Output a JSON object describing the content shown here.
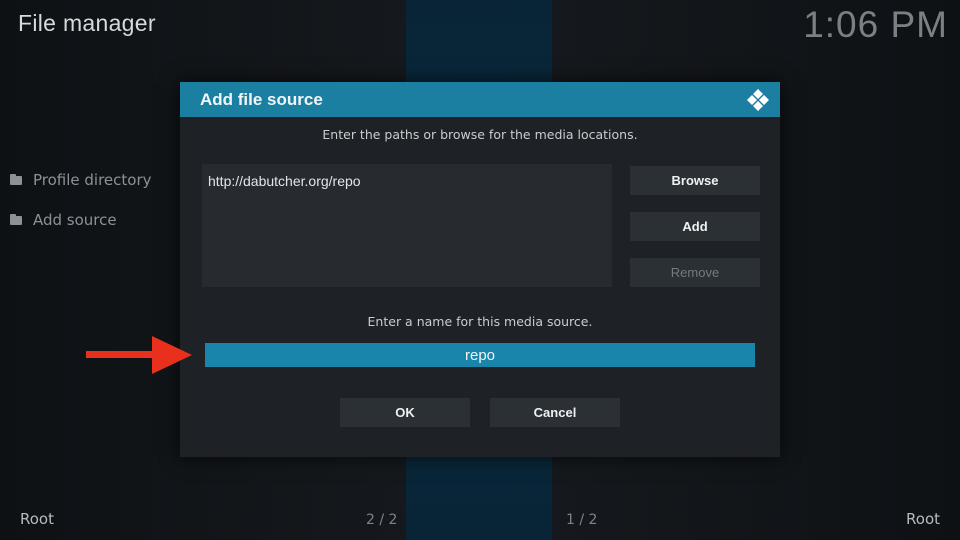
{
  "app": {
    "title": "File manager",
    "clock": "1:06 PM"
  },
  "left_panel": {
    "items": [
      {
        "label": "Profile directory",
        "icon": "folder-icon"
      },
      {
        "label": "Add source",
        "icon": "folder-icon"
      }
    ]
  },
  "footer": {
    "left_label": "Root",
    "left_count": "2 / 2",
    "right_count": "1 / 2",
    "right_label": "Root"
  },
  "dialog": {
    "title": "Add file source",
    "logo_icon": "kodi-logo-icon",
    "paths_prompt": "Enter the paths or browse for the media locations.",
    "path_value": "http://dabutcher.org/repo",
    "buttons": {
      "browse": "Browse",
      "add": "Add",
      "remove": "Remove"
    },
    "name_prompt": "Enter a name for this media source.",
    "name_value": "repo",
    "ok": "OK",
    "cancel": "Cancel"
  },
  "annotation": {
    "icon": "red-arrow-icon",
    "color": "#e8301c"
  },
  "colors": {
    "accent": "#1b7fa2",
    "input_selected": "#1a85aa"
  }
}
